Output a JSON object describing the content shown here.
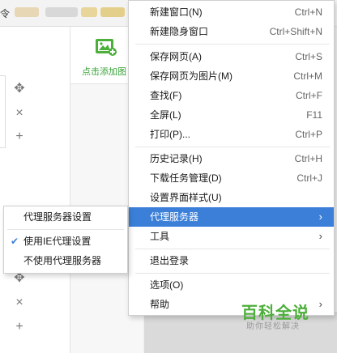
{
  "background": {
    "tab_fragment": "令",
    "add_image_label": "点击添加图"
  },
  "menu": {
    "items": [
      {
        "label": "新建窗口(N)",
        "shortcut": "Ctrl+N"
      },
      {
        "label": "新建隐身窗口",
        "shortcut": "Ctrl+Shift+N"
      },
      {
        "label": "保存网页(A)",
        "shortcut": "Ctrl+S"
      },
      {
        "label": "保存网页为图片(M)",
        "shortcut": "Ctrl+M"
      },
      {
        "label": "查找(F)",
        "shortcut": "Ctrl+F"
      },
      {
        "label": "全屏(L)",
        "shortcut": "F11"
      },
      {
        "label": "打印(P)...",
        "shortcut": "Ctrl+P"
      },
      {
        "label": "历史记录(H)",
        "shortcut": "Ctrl+H"
      },
      {
        "label": "下载任务管理(D)",
        "shortcut": "Ctrl+J"
      },
      {
        "label": "设置界面样式(U)",
        "shortcut": ""
      },
      {
        "label": "代理服务器",
        "shortcut": ""
      },
      {
        "label": "工具",
        "shortcut": ""
      },
      {
        "label": "退出登录",
        "shortcut": ""
      },
      {
        "label": "选项(O)",
        "shortcut": ""
      },
      {
        "label": "帮助",
        "shortcut": ""
      }
    ]
  },
  "submenu": {
    "items": [
      {
        "label": "代理服务器设置"
      },
      {
        "label": "使用IE代理设置",
        "checked": true
      },
      {
        "label": "不使用代理服务器"
      }
    ]
  },
  "watermark": {
    "title": "百科全说",
    "subtitle": "助你轻松解决"
  },
  "colors": {
    "highlight": "#3b7fd9",
    "watermark_green": "#4caf3a"
  }
}
